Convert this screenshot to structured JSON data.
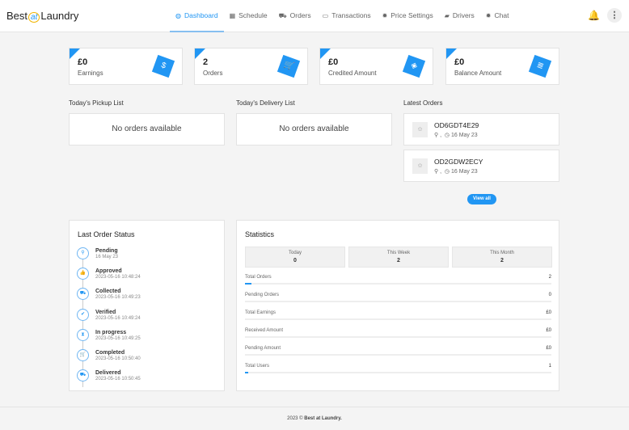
{
  "brand": {
    "pre": "Best",
    "at": "at",
    "post": "Laundry"
  },
  "nav": [
    {
      "label": "Dashboard",
      "icon": "◍"
    },
    {
      "label": "Schedule",
      "icon": "▦"
    },
    {
      "label": "Orders",
      "icon": "⛟"
    },
    {
      "label": "Transactions",
      "icon": "▭"
    },
    {
      "label": "Price Settings",
      "icon": "✹"
    },
    {
      "label": "Drivers",
      "icon": "▰"
    },
    {
      "label": "Chat",
      "icon": "✹"
    }
  ],
  "stats": [
    {
      "value": "£0",
      "label": "Earnings",
      "icon": "$"
    },
    {
      "value": "2",
      "label": "Orders",
      "icon": "🛒"
    },
    {
      "value": "£0",
      "label": "Credited Amount",
      "icon": "◈"
    },
    {
      "value": "£0",
      "label": "Balance Amount",
      "icon": "≣"
    }
  ],
  "pickup": {
    "title": "Today's Pickup List",
    "empty": "No orders available"
  },
  "delivery": {
    "title": "Today's Delivery List",
    "empty": "No orders available"
  },
  "latest": {
    "title": "Latest Orders",
    "orders": [
      {
        "id": "OD6GDT4E29",
        "loc": "⚲ ,",
        "date": "◷ 16 May 23"
      },
      {
        "id": "OD2GDW2ECY",
        "loc": "⚲ ,",
        "date": "◷ 16 May 23"
      }
    ],
    "view_all": "View all"
  },
  "status": {
    "title": "Last Order Status",
    "steps": [
      {
        "name": "Pending",
        "date": "16 May 23",
        "icon": "⚲"
      },
      {
        "name": "Approved",
        "date": "2023-05-16 10:48:24",
        "icon": "👍"
      },
      {
        "name": "Collected",
        "date": "2023-05-16 10:49:23",
        "icon": "⛟"
      },
      {
        "name": "Verified",
        "date": "2023-05-16 10:49:24",
        "icon": "✔"
      },
      {
        "name": "In progress",
        "date": "2023-05-16 10:49:25",
        "icon": "⧗"
      },
      {
        "name": "Completed",
        "date": "2023-05-16 10:50:40",
        "icon": "🛒"
      },
      {
        "name": "Delivered",
        "date": "2023-05-16 10:50:45",
        "icon": "⛟"
      }
    ]
  },
  "statistics": {
    "title": "Statistics",
    "periods": [
      {
        "label": "Today",
        "value": "0"
      },
      {
        "label": "This Week",
        "value": "2"
      },
      {
        "label": "This Month",
        "value": "2"
      }
    ],
    "rows": [
      {
        "label": "Total Orders",
        "value": "2",
        "progress": 2
      },
      {
        "label": "Pending Orders",
        "value": "0",
        "progress": 0
      },
      {
        "label": "Total Earnings",
        "value": "£0",
        "progress": 0
      },
      {
        "label": "Received Amount",
        "value": "£0",
        "progress": 0
      },
      {
        "label": "Pending Amount",
        "value": "£0",
        "progress": 0
      },
      {
        "label": "Total Users",
        "value": "1",
        "progress": 1
      }
    ]
  },
  "footer": {
    "year": "2023 © ",
    "brand": "Best at Laundry."
  }
}
